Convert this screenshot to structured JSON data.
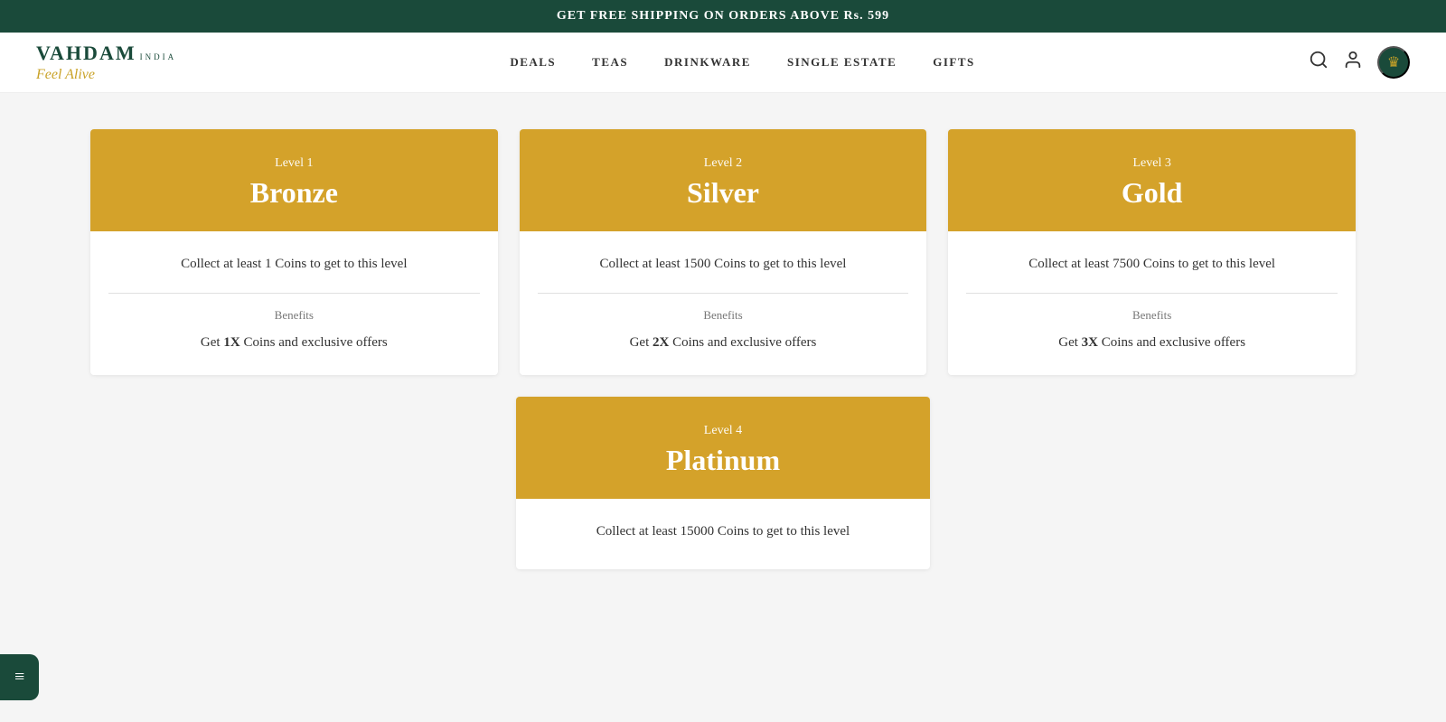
{
  "banner": {
    "text": "GET FREE SHIPPING ON ORDERS ABOVE Rs. 599"
  },
  "logo": {
    "brand": "VAHDAM",
    "india": "INDIA",
    "tagline": "Feel Alive"
  },
  "nav": {
    "items": [
      "DEALS",
      "TEAS",
      "DRINKWARE",
      "SINGLE ESTATE",
      "GIFTS"
    ]
  },
  "levels": [
    {
      "label": "Level 1",
      "name": "Bronze",
      "collect_text": "Collect at least 1 Coins to get to this level",
      "benefits_label": "Benefits",
      "benefits_text_pre": "Get ",
      "multiplier": "1X",
      "benefits_text_post": " Coins and exclusive offers"
    },
    {
      "label": "Level 2",
      "name": "Silver",
      "collect_text": "Collect at least 1500 Coins to get to this level",
      "benefits_label": "Benefits",
      "benefits_text_pre": "Get ",
      "multiplier": "2X",
      "benefits_text_post": " Coins and exclusive offers"
    },
    {
      "label": "Level 3",
      "name": "Gold",
      "collect_text": "Collect at least 7500 Coins to get to this level",
      "benefits_label": "Benefits",
      "benefits_text_pre": "Get ",
      "multiplier": "3X",
      "benefits_text_post": " Coins and exclusive offers"
    }
  ],
  "platinum": {
    "label": "Level 4",
    "name": "Platinum",
    "collect_text": "Collect at least 15000 Coins to get to this level"
  },
  "chat": {
    "icon": "≡"
  }
}
